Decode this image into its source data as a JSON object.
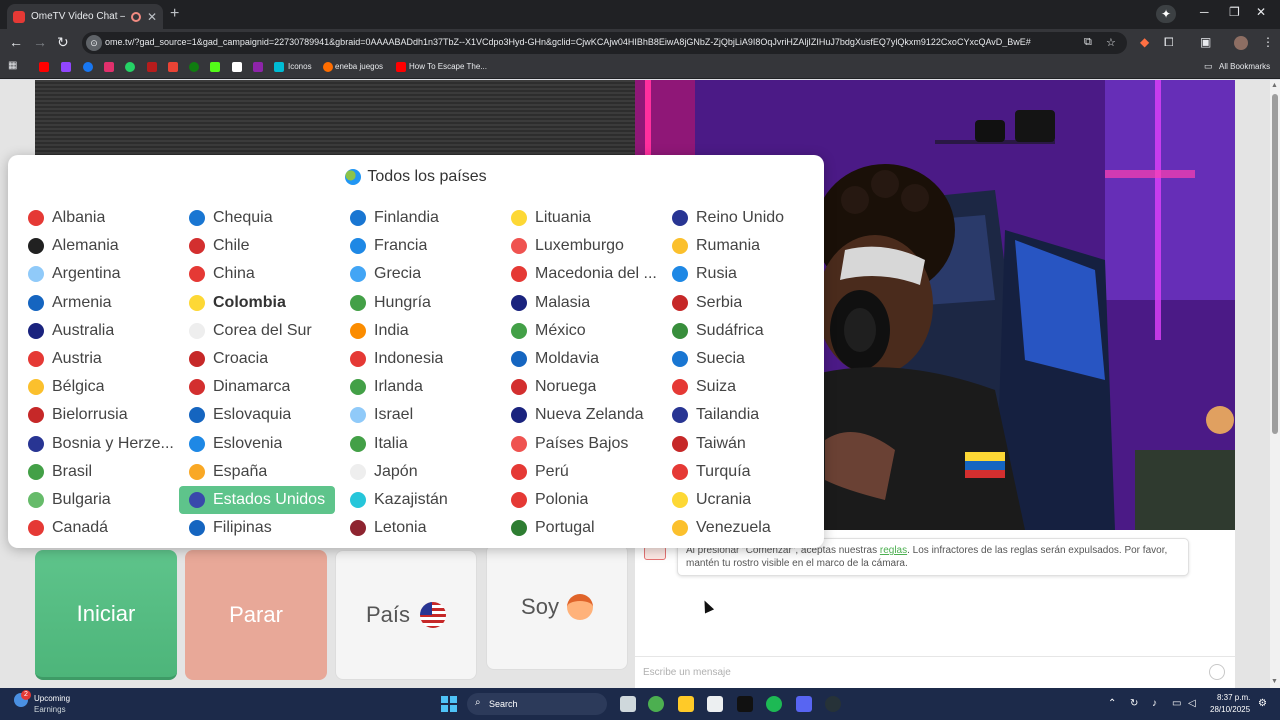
{
  "browser": {
    "tab_title": "OmeTV Video Chat — OmeTV",
    "url": "ome.tv/?gad_source=1&gad_campaignid=22730789941&gbraid=0AAAABADdh1n37TbZ--X1VCdpo3Hyd-GHn&gclid=CjwKCAjw04HIBhB8EiwA8jGNbZ-ZjQbjLiA9I8OqJvriHZAljIZIHuJ7bdgXusfEQ7ylQkxm9122CxoCYxcQAvD_BwE#",
    "bookmarks": [
      "Iconos",
      "eneba juegos",
      "How To Escape The..."
    ],
    "all_bookmarks": "All Bookmarks"
  },
  "popup": {
    "title": "Todos los países",
    "columns": [
      [
        {
          "name": "Albania",
          "c": "#e53935"
        },
        {
          "name": "Alemania",
          "c": "#212121"
        },
        {
          "name": "Argentina",
          "c": "#90caf9"
        },
        {
          "name": "Armenia",
          "c": "#1565c0"
        },
        {
          "name": "Australia",
          "c": "#1a237e"
        },
        {
          "name": "Austria",
          "c": "#e53935"
        },
        {
          "name": "Bélgica",
          "c": "#fbc02d"
        },
        {
          "name": "Bielorrusia",
          "c": "#c62828"
        },
        {
          "name": "Bosnia y Herze...",
          "c": "#283593"
        },
        {
          "name": "Brasil",
          "c": "#43a047"
        },
        {
          "name": "Bulgaria",
          "c": "#66bb6a"
        },
        {
          "name": "Canadá",
          "c": "#e53935"
        }
      ],
      [
        {
          "name": "Chequia",
          "c": "#1976d2"
        },
        {
          "name": "Chile",
          "c": "#d32f2f"
        },
        {
          "name": "China",
          "c": "#e53935"
        },
        {
          "name": "Colombia",
          "c": "#fdd835",
          "bold": true
        },
        {
          "name": "Corea del Sur",
          "c": "#eeeeee"
        },
        {
          "name": "Croacia",
          "c": "#c62828"
        },
        {
          "name": "Dinamarca",
          "c": "#d32f2f"
        },
        {
          "name": "Eslovaquia",
          "c": "#1565c0"
        },
        {
          "name": "Eslovenia",
          "c": "#1e88e5"
        },
        {
          "name": "España",
          "c": "#f9a825"
        },
        {
          "name": "Estados Unidos",
          "c": "#3949ab",
          "selected": true
        },
        {
          "name": "Filipinas",
          "c": "#1565c0"
        }
      ],
      [
        {
          "name": "Finlandia",
          "c": "#1976d2"
        },
        {
          "name": "Francia",
          "c": "#1e88e5"
        },
        {
          "name": "Grecia",
          "c": "#42a5f5"
        },
        {
          "name": "Hungría",
          "c": "#43a047"
        },
        {
          "name": "India",
          "c": "#fb8c00"
        },
        {
          "name": "Indonesia",
          "c": "#e53935"
        },
        {
          "name": "Irlanda",
          "c": "#43a047"
        },
        {
          "name": "Israel",
          "c": "#90caf9"
        },
        {
          "name": "Italia",
          "c": "#43a047"
        },
        {
          "name": "Japón",
          "c": "#eeeeee"
        },
        {
          "name": "Kazajistán",
          "c": "#26c6da"
        },
        {
          "name": "Letonia",
          "c": "#8e2430"
        }
      ],
      [
        {
          "name": "Lituania",
          "c": "#fdd835"
        },
        {
          "name": "Luxemburgo",
          "c": "#ef5350"
        },
        {
          "name": "Macedonia del ...",
          "c": "#e53935"
        },
        {
          "name": "Malasia",
          "c": "#1a237e"
        },
        {
          "name": "México",
          "c": "#43a047"
        },
        {
          "name": "Moldavia",
          "c": "#1565c0"
        },
        {
          "name": "Noruega",
          "c": "#d32f2f"
        },
        {
          "name": "Nueva Zelanda",
          "c": "#1a237e"
        },
        {
          "name": "Países Bajos",
          "c": "#ef5350"
        },
        {
          "name": "Perú",
          "c": "#e53935"
        },
        {
          "name": "Polonia",
          "c": "#e53935"
        },
        {
          "name": "Portugal",
          "c": "#2e7d32"
        }
      ],
      [
        {
          "name": "Reino Unido",
          "c": "#283593"
        },
        {
          "name": "Rumania",
          "c": "#fbc02d"
        },
        {
          "name": "Rusia",
          "c": "#1e88e5"
        },
        {
          "name": "Serbia",
          "c": "#c62828"
        },
        {
          "name": "Sudáfrica",
          "c": "#388e3c"
        },
        {
          "name": "Suecia",
          "c": "#1976d2"
        },
        {
          "name": "Suiza",
          "c": "#e53935"
        },
        {
          "name": "Tailandia",
          "c": "#283593"
        },
        {
          "name": "Taiwán",
          "c": "#c62828"
        },
        {
          "name": "Turquía",
          "c": "#e53935"
        },
        {
          "name": "Ucrania",
          "c": "#fdd835"
        },
        {
          "name": "Venezuela",
          "c": "#fbc02d"
        }
      ]
    ]
  },
  "buttons": {
    "start": "Iniciar",
    "stop": "Parar",
    "country": "País",
    "gender": "Soy"
  },
  "chat": {
    "message_pre": "Al presionar \"Comenzar\", aceptas nuestras ",
    "message_link": "reglas",
    "message_post": ". Los infractores de las reglas serán expulsados. Por favor, mantén tu rostro visible en el marco de la cámara.",
    "input_placeholder": "Escribe un mensaje"
  },
  "taskbar": {
    "widget_badge": "2",
    "widget_title": "Upcoming",
    "widget_subtitle": "Earnings",
    "search_label": "Search",
    "time": "8:37 p.m.",
    "date": "28/10/2025"
  }
}
